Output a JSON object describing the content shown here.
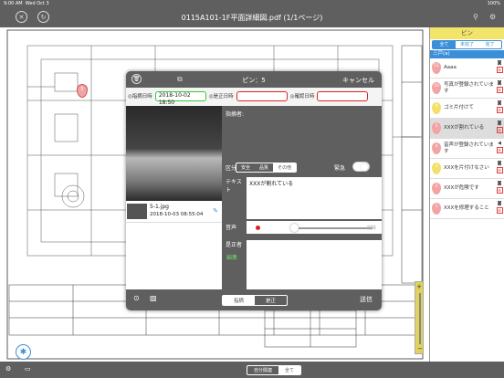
{
  "status_bar": {
    "time": "9:00 AM",
    "date": "Wed Oct 3",
    "battery": "100%"
  },
  "header": {
    "title": "0115A101-1F平面詳細図.pdf (1/1ページ)"
  },
  "side_panel": {
    "title": "ピン",
    "filters": [
      "全て",
      "未完了",
      "完了"
    ],
    "active_filter": "全て",
    "floor": "三戸(a)",
    "pins": [
      {
        "num": "11",
        "text": "Aaaa",
        "color": "#f2a3a3",
        "has_camera": true,
        "status": "未"
      },
      {
        "num": "10",
        "text": "写真が登録されています",
        "color": "#f2a3a3",
        "has_camera": true,
        "status": "未"
      },
      {
        "num": "9",
        "text": "ゴミ片付けて",
        "color": "#f3e06a",
        "has_camera": true,
        "status": "未"
      },
      {
        "num": "5",
        "text": "XXXが割れている",
        "color": "#f2a3a3",
        "has_camera": true,
        "status": "未"
      },
      {
        "num": "4",
        "text": "音声が登録されています",
        "color": "#f2a3a3",
        "has_camera": false,
        "status": "未"
      },
      {
        "num": "3",
        "text": "XXXを片付けなさい",
        "color": "#f3e06a",
        "has_camera": true,
        "status": "未"
      },
      {
        "num": "2",
        "text": "XXXが危険です",
        "color": "#f2a3a3",
        "has_camera": true,
        "status": "未"
      },
      {
        "num": "1",
        "text": "XXXを修理すること",
        "color": "#f2a3a3",
        "has_camera": true,
        "status": "未"
      }
    ]
  },
  "map_pins": [
    {
      "num": "5"
    }
  ],
  "modal": {
    "title": "ピン：5",
    "cancel": "キャンセル",
    "date_labels": [
      "◎指摘日時",
      "◎是正日時",
      "◎確認日時"
    ],
    "date_values": [
      "2018-10-02 18:50",
      "",
      ""
    ],
    "section_header": "指摘者:",
    "category_label": "区分",
    "categories": [
      "安全",
      "品質",
      "その他"
    ],
    "active_category": "その他",
    "urgent_label": "緊急",
    "text_label": "テキスト",
    "text_value": "XXXが割れている",
    "audio_label": "音声",
    "delete_label": "削除",
    "corrector_label": "是正者",
    "edit_label": "編集",
    "photo_file": "5-1.jpg",
    "photo_date": "2018-10-03 08:55:04",
    "footer_tabs": [
      "指摘",
      "是正"
    ],
    "active_footer_tab": "指摘",
    "send": "送信"
  },
  "bottom_bar": {
    "tabs": [
      "自分関連",
      "全て"
    ],
    "active_tab": "全て"
  }
}
